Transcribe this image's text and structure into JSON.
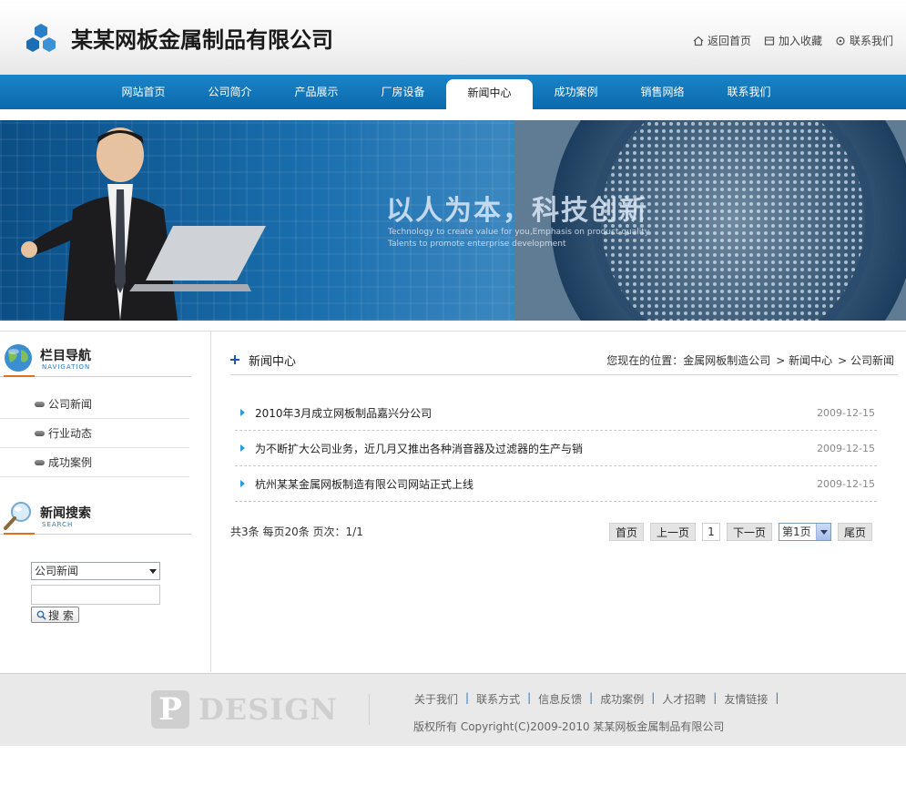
{
  "header": {
    "company_name": "某某网板金属制品有限公司",
    "links": [
      {
        "label": "返回首页",
        "icon": "home-icon"
      },
      {
        "label": "加入收藏",
        "icon": "bookmark-icon"
      },
      {
        "label": "联系我们",
        "icon": "contact-icon"
      }
    ]
  },
  "nav": {
    "items": [
      "网站首页",
      "公司简介",
      "产品展示",
      "厂房设备",
      "新闻中心",
      "成功案例",
      "销售网络",
      "联系我们"
    ],
    "active": "新闻中心"
  },
  "banner": {
    "title": "以人为本，科技创新",
    "subtitle1": "Technology to create value for you,Emphasis on product quality",
    "subtitle2": "Talents to promote enterprise development"
  },
  "sidebar": {
    "nav_title": "栏目导航",
    "nav_title_en": "NAVIGATION",
    "items": [
      "公司新闻",
      "行业动态",
      "成功案例"
    ],
    "search_title": "新闻搜索",
    "search_title_en": "SEARCH",
    "search_category": "公司新闻",
    "search_query": "",
    "search_button": "搜 索"
  },
  "main": {
    "section_title": "新闻中心",
    "breadcrumb": {
      "prefix": "您现在的位置：",
      "items": [
        "金属网板制造公司",
        "> 新闻中心",
        "> 公司新闻"
      ]
    },
    "news": [
      {
        "title": "2010年3月成立网板制品嘉兴分公司",
        "date": "2009-12-15"
      },
      {
        "title": "为不断扩大公司业务，近几月又推出各种消音器及过滤器的生产与销",
        "date": "2009-12-15"
      },
      {
        "title": "杭州某某金属网板制造有限公司网站正式上线",
        "date": "2009-12-15"
      }
    ],
    "pager": {
      "info": "共3条  每页20条  页次：1/1",
      "first": "首页",
      "prev": "上一页",
      "current": "1",
      "next": "下一页",
      "select_value": "第1页",
      "last": "尾页"
    }
  },
  "footer": {
    "logo_letter": "P",
    "logo_text": "DESIGN",
    "links": [
      "关于我们",
      "联系方式",
      "信息反馈",
      "成功案例",
      "人才招聘",
      "友情链接"
    ],
    "copyright": "版权所有  Copyright(C)2009-2010 某某网板金属制品有限公司"
  },
  "colors": {
    "nav_blue": "#0b6aae",
    "accent_orange": "#e07020",
    "link_blue": "#2a7ac0"
  }
}
